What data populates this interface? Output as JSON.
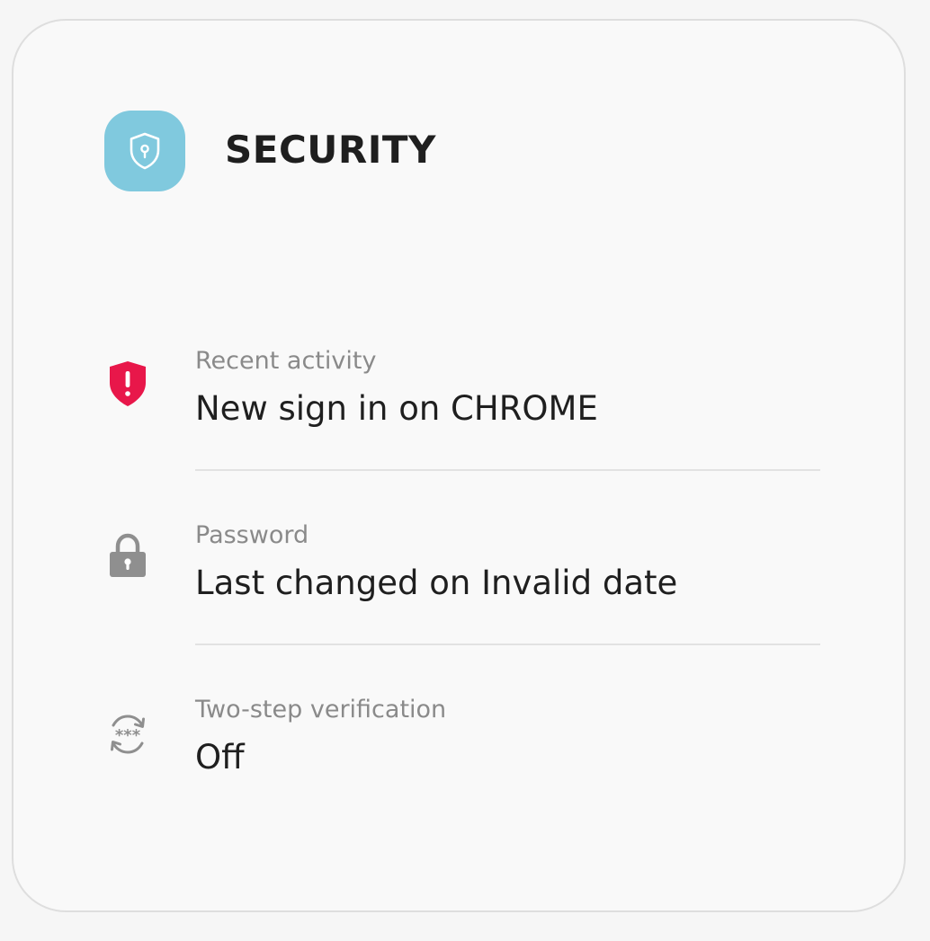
{
  "header": {
    "title": "SECURITY",
    "icon": "shield-lock-icon",
    "icon_bg": "#80c9de"
  },
  "items": [
    {
      "label": "Recent activity",
      "value": "New sign in on CHROME",
      "icon": "shield-alert-icon",
      "icon_color": "#e8174a"
    },
    {
      "label": "Password",
      "value": "Last changed on Invalid date",
      "icon": "lock-icon",
      "icon_color": "#8f8f8f"
    },
    {
      "label": "Two-step verification",
      "value": "Off",
      "icon": "two-step-refresh-icon",
      "icon_color": "#8f8f8f"
    }
  ]
}
